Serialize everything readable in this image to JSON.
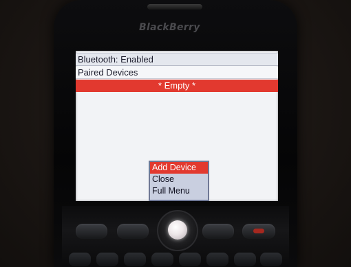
{
  "device": {
    "brand": "BlackBerry"
  },
  "screen": {
    "status_line": "Bluetooth: Enabled",
    "section_header": "Paired Devices",
    "empty_label": "* Empty *"
  },
  "context_menu": {
    "items": [
      {
        "label": "Add Device",
        "selected": true
      },
      {
        "label": "Close",
        "selected": false
      },
      {
        "label": "Full Menu",
        "selected": false
      }
    ]
  },
  "colors": {
    "highlight": "#e2392f",
    "screen_bg": "#f2f3f6",
    "menu_bg": "#c9cfe0"
  },
  "icons": [
    "send-key-icon",
    "menu-key-icon",
    "trackball-icon",
    "back-key-icon",
    "end-call-icon"
  ]
}
